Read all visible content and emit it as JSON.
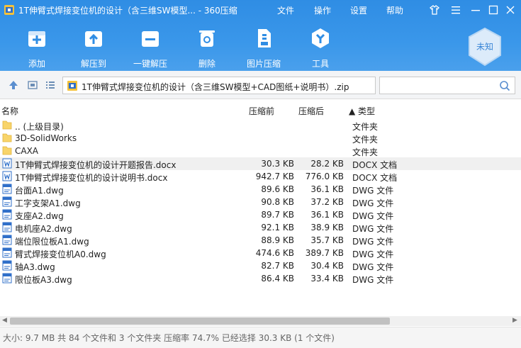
{
  "window": {
    "title": "1T伸臂式焊接变位机的设计（含三维SW模型... - 360压缩",
    "menu": [
      "文件",
      "操作",
      "设置",
      "帮助"
    ]
  },
  "toolbar": {
    "items": [
      {
        "label": "添加",
        "icon": "add-icon"
      },
      {
        "label": "解压到",
        "icon": "extract-to-icon"
      },
      {
        "label": "一键解压",
        "icon": "one-click-extract-icon"
      },
      {
        "label": "删除",
        "icon": "delete-icon"
      },
      {
        "label": "图片压缩",
        "icon": "image-compress-icon"
      },
      {
        "label": "工具",
        "icon": "tools-icon"
      }
    ],
    "badge": "未知"
  },
  "address": {
    "path": "1T伸臂式焊接变位机的设计（含三维SW模型+CAD图纸+说明书）.zip",
    "search_placeholder": ""
  },
  "columns": {
    "name": "名称",
    "before": "压缩前",
    "after": "压缩后",
    "type": "▲ 类型"
  },
  "files": [
    {
      "name": ".. (上级目录)",
      "before": "",
      "after": "",
      "type": "文件夹",
      "kind": "folder"
    },
    {
      "name": "3D-SolidWorks",
      "before": "",
      "after": "",
      "type": "文件夹",
      "kind": "folder"
    },
    {
      "name": "CAXA",
      "before": "",
      "after": "",
      "type": "文件夹",
      "kind": "folder"
    },
    {
      "name": "1T伸臂式焊接变位机的设计开题报告.docx",
      "before": "30.3 KB",
      "after": "28.2 KB",
      "type": "DOCX 文档",
      "kind": "docx",
      "selected": true
    },
    {
      "name": "1T伸臂式焊接变位机的设计说明书.docx",
      "before": "942.7 KB",
      "after": "776.0 KB",
      "type": "DOCX 文档",
      "kind": "docx"
    },
    {
      "name": "台面A1.dwg",
      "before": "89.6 KB",
      "after": "36.1 KB",
      "type": "DWG 文件",
      "kind": "dwg"
    },
    {
      "name": "工字支架A1.dwg",
      "before": "90.8 KB",
      "after": "37.2 KB",
      "type": "DWG 文件",
      "kind": "dwg"
    },
    {
      "name": "支座A2.dwg",
      "before": "89.7 KB",
      "after": "36.1 KB",
      "type": "DWG 文件",
      "kind": "dwg"
    },
    {
      "name": "电机座A2.dwg",
      "before": "92.1 KB",
      "after": "38.9 KB",
      "type": "DWG 文件",
      "kind": "dwg"
    },
    {
      "name": "端位限位板A1.dwg",
      "before": "88.9 KB",
      "after": "35.7 KB",
      "type": "DWG 文件",
      "kind": "dwg"
    },
    {
      "name": "臂式焊接变位机A0.dwg",
      "before": "474.6 KB",
      "after": "389.7 KB",
      "type": "DWG 文件",
      "kind": "dwg"
    },
    {
      "name": "轴A3.dwg",
      "before": "82.7 KB",
      "after": "30.4 KB",
      "type": "DWG 文件",
      "kind": "dwg"
    },
    {
      "name": "限位板A3.dwg",
      "before": "86.4 KB",
      "after": "33.4 KB",
      "type": "DWG 文件",
      "kind": "dwg"
    }
  ],
  "status": "大小: 9.7 MB 共 84 个文件和 3 个文件夹 压缩率 74.7% 已经选择 30.3 KB (1 个文件)"
}
